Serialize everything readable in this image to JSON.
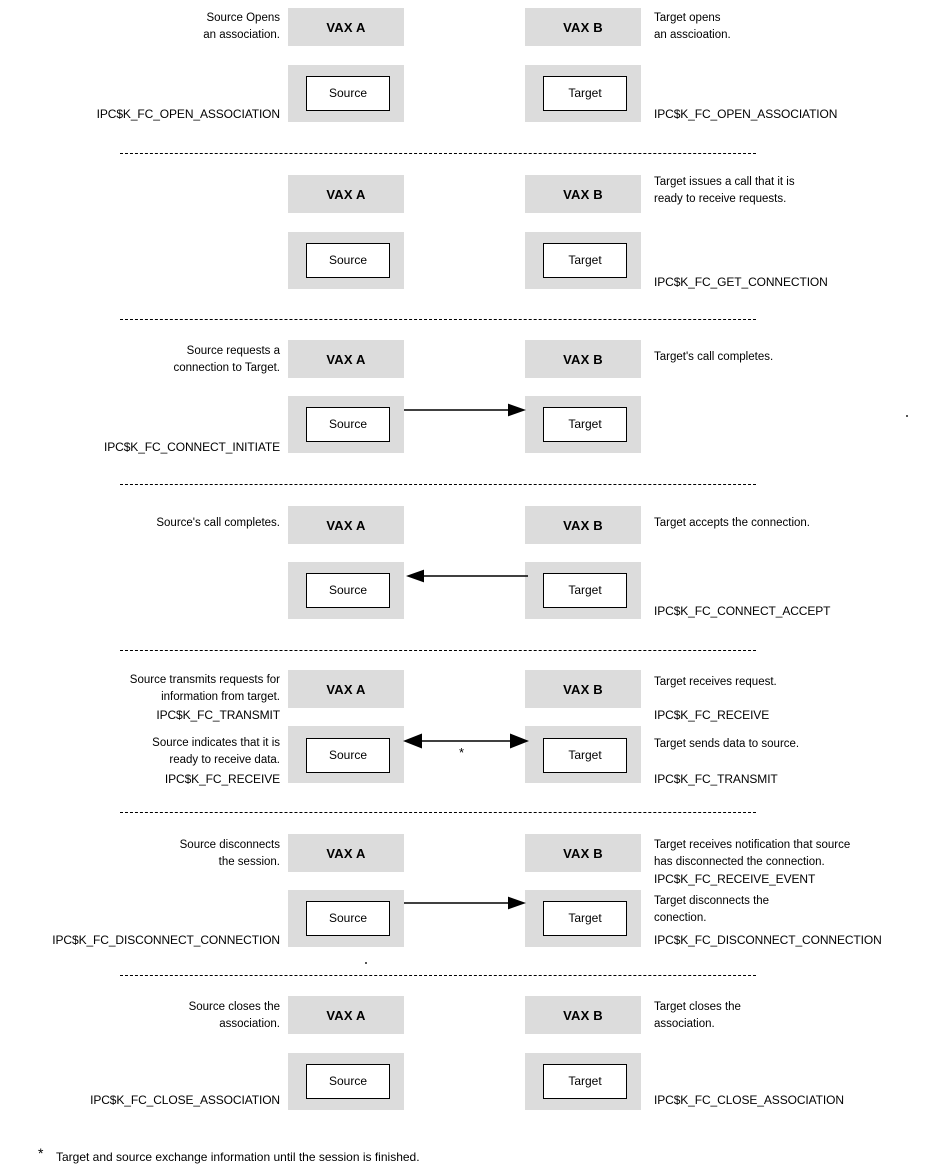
{
  "diagram": {
    "machine_left": "VAX A",
    "machine_right": "VAX B",
    "node_left": "Source",
    "node_right": "Target",
    "accent_band_color": "#dcdcdc",
    "line_color": "#000000",
    "footnote": {
      "marker": "*",
      "text": "Target and source exchange information until the session is finished."
    },
    "sections": [
      {
        "id": "open-association",
        "left_top": "Source Opens\nan association.",
        "left_code": "IPC$K_FC_OPEN_ASSOCIATION",
        "right_top": "Target opens\nan asscioation.",
        "right_code": "IPC$K_FC_OPEN_ASSOCIATION",
        "arrow": "none"
      },
      {
        "id": "get-connection",
        "left_top": "",
        "left_code": "",
        "right_top": "Target issues a call that it is\nready to receive requests.",
        "right_code": "IPC$K_FC_GET_CONNECTION",
        "arrow": "none"
      },
      {
        "id": "connect-initiate",
        "left_top": "Source requests a\nconnection to Target.",
        "left_code": "IPC$K_FC_CONNECT_INITIATE",
        "right_top": "Target's call completes.",
        "right_code": "",
        "arrow": "right"
      },
      {
        "id": "connect-accept",
        "left_top": "Source's call completes.",
        "left_code": "",
        "right_top": "Target accepts the connection.",
        "right_code": "IPC$K_FC_CONNECT_ACCEPT",
        "arrow": "left"
      },
      {
        "id": "transmit-receive",
        "left_top": "Source transmits requests for\ninformation from target.",
        "left_code": "IPC$K_FC_TRANSMIT",
        "left_mid": "Source indicates that it is\nready to receive data.",
        "left_code2": "IPC$K_FC_RECEIVE",
        "right_top": "Target receives request.",
        "right_code": "IPC$K_FC_RECEIVE",
        "right_mid": "Target sends data to source.",
        "right_code2": "IPC$K_FC_TRANSMIT",
        "arrow": "both",
        "arrow_marker": "*"
      },
      {
        "id": "disconnect-connection",
        "left_top": "Source disconnects\nthe session.",
        "left_code": "IPC$K_FC_DISCONNECT_CONNECTION",
        "right_top": "Target receives notification that source\nhas disconnected the connection.",
        "right_code": "IPC$K_FC_RECEIVE_EVENT",
        "right_mid": "Target disconnects the\nconection.",
        "right_code2": "IPC$K_FC_DISCONNECT_CONNECTION",
        "arrow": "right"
      },
      {
        "id": "close-association",
        "left_top": "Source closes the\nassociation.",
        "left_code": "IPC$K_FC_CLOSE_ASSOCIATION",
        "right_top": "Target closes the\nassociation.",
        "right_code": "IPC$K_FC_CLOSE_ASSOCIATION",
        "arrow": "none"
      }
    ]
  }
}
